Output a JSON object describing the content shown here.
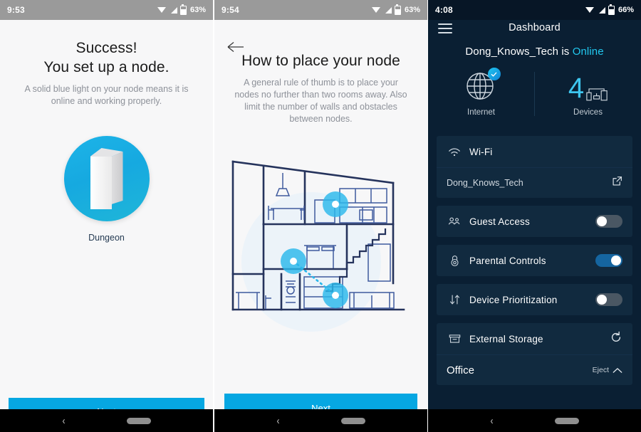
{
  "colors": {
    "accent_cyan": "#06a7e2",
    "dashboard_bg": "#0a1f33",
    "card_bg": "#112a3f",
    "online_cyan": "#22c9f0",
    "toggle_on": "#1565a0",
    "toggle_off": "#4a5763",
    "house_navy": "#25335c"
  },
  "panel1": {
    "statusbar": {
      "time": "9:53",
      "battery": "63%",
      "icons": [
        "wifi-icon",
        "signal-icon",
        "battery-icon"
      ]
    },
    "title_line1": "Success!",
    "title_line2": "You set up a node.",
    "subtitle": "A solid blue light on your node means it is online and working properly.",
    "node_label": "Dungeon",
    "next_label": "Next",
    "nav": {
      "back": "‹",
      "pill": "home-pill"
    }
  },
  "panel2": {
    "statusbar": {
      "time": "9:54",
      "battery": "63%",
      "icons": [
        "wifi-icon",
        "signal-icon",
        "battery-icon"
      ]
    },
    "back_icon": "back-arrow-icon",
    "title": "How to place your node",
    "subtitle": "A general rule of thumb is to place your nodes no further than two rooms away. Also limit the number of walls and obstacles between nodes.",
    "illustration": "house-cross-section-diagram",
    "next_label": "Next",
    "nav": {
      "back": "‹",
      "pill": "home-pill"
    }
  },
  "panel3": {
    "statusbar": {
      "time": "4:08",
      "battery": "66%",
      "icons": [
        "wifi-icon",
        "signal-icon",
        "battery-icon"
      ]
    },
    "menu_icon": "hamburger-menu-icon",
    "title": "Dashboard",
    "status_prefix": "Dong_Knows_Tech is",
    "status_value": "Online",
    "stats": {
      "internet": {
        "label": "Internet",
        "icon": "globe-icon",
        "badge": "check-badge"
      },
      "devices": {
        "label": "Devices",
        "count": "4",
        "icon": "devices-icon"
      }
    },
    "rows": [
      {
        "name": "wifi",
        "icon": "wifi-icon",
        "label": "Wi-Fi",
        "sub_label": "Dong_Knows_Tech",
        "sub_action_icon": "external-link-icon"
      },
      {
        "name": "guest-access",
        "icon": "guests-icon",
        "label": "Guest Access",
        "toggle": "off"
      },
      {
        "name": "parental-controls",
        "icon": "lock-icon",
        "label": "Parental Controls",
        "toggle": "on"
      },
      {
        "name": "device-prioritization",
        "icon": "arrows-updown-icon",
        "label": "Device Prioritization",
        "toggle": "off"
      },
      {
        "name": "external-storage",
        "icon": "storage-icon",
        "label": "External Storage",
        "action_icon": "refresh-icon",
        "sub_label": "Office",
        "sub_action": "Eject",
        "sub_action_icon": "eject-icon"
      }
    ],
    "nav": {
      "back": "‹",
      "pill": "home-pill"
    }
  }
}
